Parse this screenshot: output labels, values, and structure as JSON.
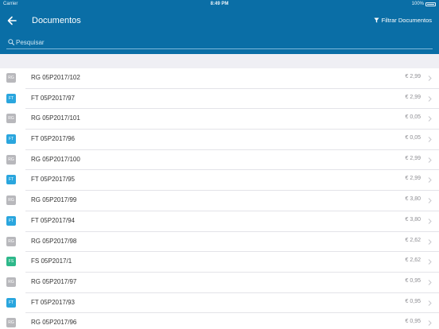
{
  "status_bar": {
    "carrier": "Carrier",
    "time": "8:49 PM",
    "battery": "100%"
  },
  "nav": {
    "title": "Documentos",
    "filter_label": "Filtrar Documentos"
  },
  "search": {
    "placeholder": "Pesquisar"
  },
  "colors": {
    "header": "#0a6ea6",
    "badge_rg": "#b8b8bc",
    "badge_ft": "#2aa6de",
    "badge_fs": "#2eb88a"
  },
  "documents": [
    {
      "type": "RG",
      "name": "RG 05P2017/102",
      "amount": "€ 2,99"
    },
    {
      "type": "FT",
      "name": "FT 05P2017/97",
      "amount": "€ 2,99"
    },
    {
      "type": "RG",
      "name": "RG 05P2017/101",
      "amount": "€ 0,05"
    },
    {
      "type": "FT",
      "name": "FT 05P2017/96",
      "amount": "€ 0,05"
    },
    {
      "type": "RG",
      "name": "RG 05P2017/100",
      "amount": "€ 2,99"
    },
    {
      "type": "FT",
      "name": "FT 05P2017/95",
      "amount": "€ 2,99"
    },
    {
      "type": "RG",
      "name": "RG 05P2017/99",
      "amount": "€ 3,80"
    },
    {
      "type": "FT",
      "name": "FT 05P2017/94",
      "amount": "€ 3,80"
    },
    {
      "type": "RG",
      "name": "RG 05P2017/98",
      "amount": "€ 2,62"
    },
    {
      "type": "FS",
      "name": "FS 05P2017/1",
      "amount": "€ 2,62"
    },
    {
      "type": "RG",
      "name": "RG 05P2017/97",
      "amount": "€ 0,95"
    },
    {
      "type": "FT",
      "name": "FT 05P2017/93",
      "amount": "€ 0,95"
    },
    {
      "type": "RG",
      "name": "RG 05P2017/96",
      "amount": "€ 0,95"
    }
  ]
}
